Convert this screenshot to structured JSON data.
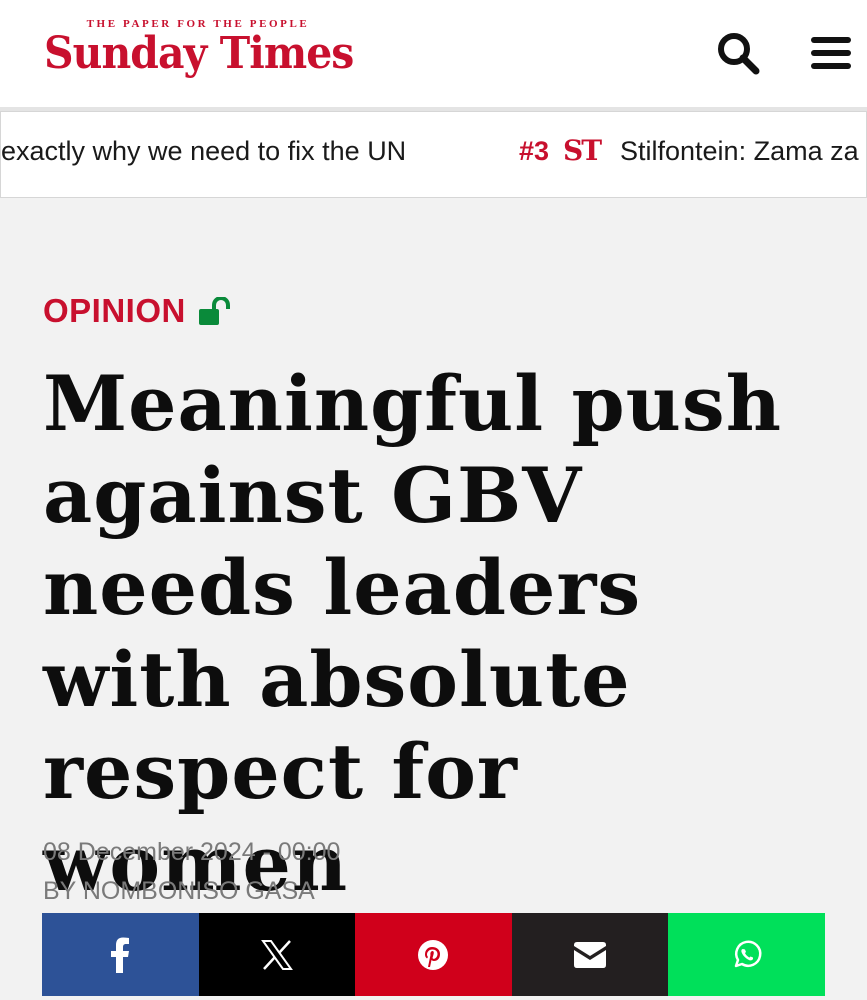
{
  "header": {
    "tagline": "THE PAPER FOR THE PEOPLE",
    "logo_text": "Sunday Times",
    "brand_color": "#c8102e",
    "search_icon": "search-icon",
    "menu_icon": "hamburger-menu-icon"
  },
  "ticker": {
    "items": [
      {
        "text": "exactly why we need to fix the UN"
      },
      {
        "number": "#3",
        "logo": "ST",
        "text": "Stilfontein: Zama za"
      }
    ]
  },
  "article": {
    "category": "OPINION",
    "lock_icon": "unlocked-padlock-icon",
    "lock_color": "#0a8a3a",
    "headline": "Meaningful push against GBV needs leaders with absolute respect for women",
    "date": "08 December 2024 - 00:00",
    "byline": "BY NOMBONISO GASA"
  },
  "share": {
    "buttons": [
      {
        "name": "facebook",
        "icon": "facebook-icon",
        "color": "#2d5297"
      },
      {
        "name": "x",
        "icon": "x-icon",
        "color": "#000000"
      },
      {
        "name": "pinterest",
        "icon": "pinterest-icon",
        "color": "#d0001b"
      },
      {
        "name": "email",
        "icon": "email-icon",
        "color": "#231f20"
      },
      {
        "name": "whatsapp",
        "icon": "whatsapp-icon",
        "color": "#00e05a"
      }
    ]
  }
}
